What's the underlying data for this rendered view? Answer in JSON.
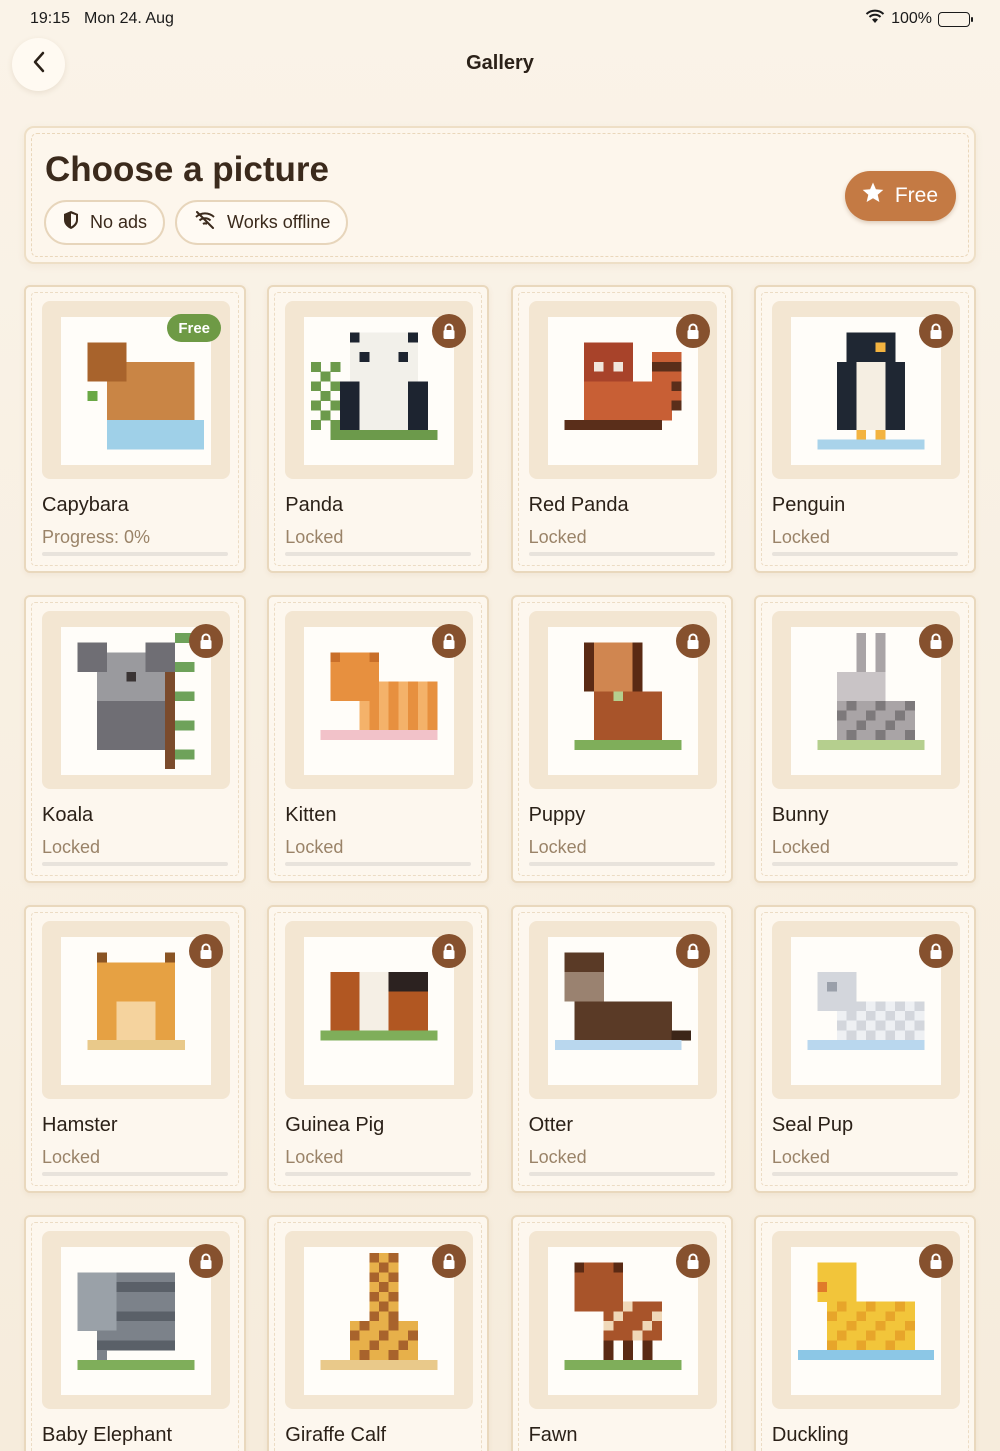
{
  "status_bar": {
    "time": "19:15",
    "date": "Mon 24. Aug",
    "battery": "100%",
    "icons": [
      "wifi-icon",
      "battery-icon"
    ]
  },
  "nav": {
    "title": "Gallery",
    "back_icon": "chevron-left-icon"
  },
  "header": {
    "title": "Choose a picture",
    "chips": [
      {
        "icon": "shield-icon",
        "label": "No ads"
      },
      {
        "icon": "wifi-off-icon",
        "label": "Works offline"
      }
    ],
    "free_button": {
      "icon": "star-icon",
      "label": "Free"
    }
  },
  "colors": {
    "accent": "#c47a44",
    "free_badge": "#6e9a45",
    "lock_badge": "#86512e",
    "background": "#f8f0e4"
  },
  "cards": [
    {
      "title": "Capybara",
      "status": "Progress: 0%",
      "progress": 0,
      "badge": "Free",
      "locked": false,
      "art": "capybara"
    },
    {
      "title": "Panda",
      "status": "Locked",
      "locked": true,
      "art": "panda"
    },
    {
      "title": "Red Panda",
      "status": "Locked",
      "locked": true,
      "art": "red-panda"
    },
    {
      "title": "Penguin",
      "status": "Locked",
      "locked": true,
      "art": "penguin"
    },
    {
      "title": "Koala",
      "status": "Locked",
      "locked": true,
      "art": "koala"
    },
    {
      "title": "Kitten",
      "status": "Locked",
      "locked": true,
      "art": "kitten"
    },
    {
      "title": "Puppy",
      "status": "Locked",
      "locked": true,
      "art": "puppy"
    },
    {
      "title": "Bunny",
      "status": "Locked",
      "locked": true,
      "art": "bunny"
    },
    {
      "title": "Hamster",
      "status": "Locked",
      "locked": true,
      "art": "hamster"
    },
    {
      "title": "Guinea Pig",
      "status": "Locked",
      "locked": true,
      "art": "guinea-pig"
    },
    {
      "title": "Otter",
      "status": "Locked",
      "locked": true,
      "art": "otter"
    },
    {
      "title": "Seal Pup",
      "status": "Locked",
      "locked": true,
      "art": "seal-pup"
    },
    {
      "title": "Baby Elephant",
      "status": "",
      "locked": true,
      "art": "baby-elephant"
    },
    {
      "title": "Giraffe Calf",
      "status": "",
      "locked": true,
      "art": "giraffe-calf"
    },
    {
      "title": "Fawn",
      "status": "",
      "locked": true,
      "art": "fawn"
    },
    {
      "title": "Duckling",
      "status": "",
      "locked": true,
      "art": "duckling"
    }
  ]
}
